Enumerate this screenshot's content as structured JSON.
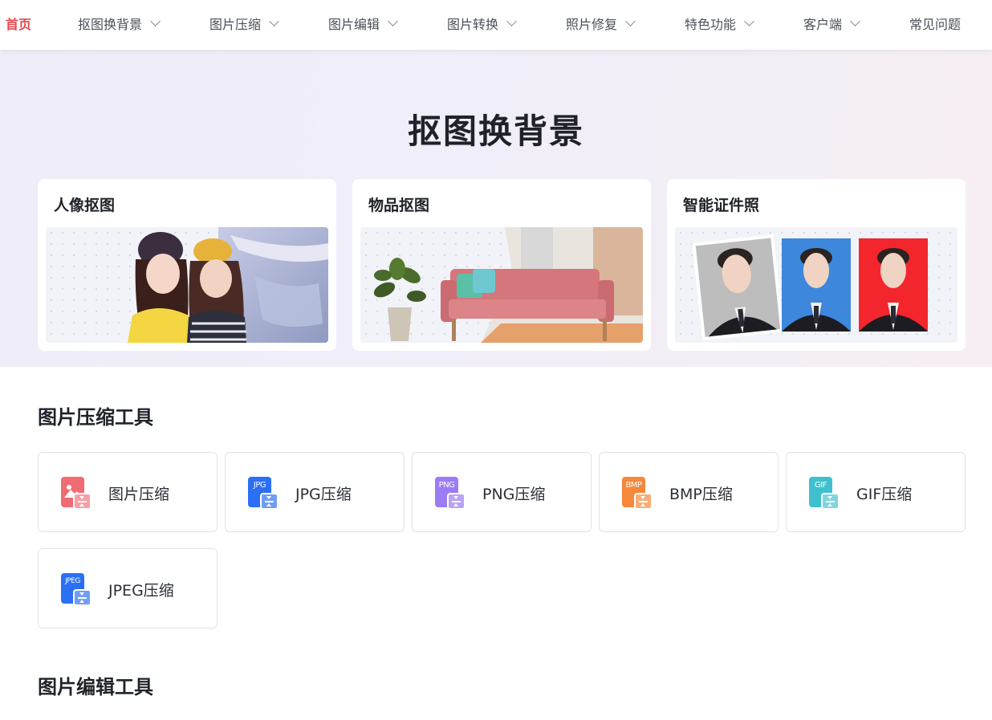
{
  "nav": {
    "home": "首页",
    "items": [
      {
        "label": "抠图换背景"
      },
      {
        "label": "图片压缩"
      },
      {
        "label": "图片编辑"
      },
      {
        "label": "图片转换"
      },
      {
        "label": "照片修复"
      },
      {
        "label": "特色功能"
      },
      {
        "label": "客户端"
      }
    ],
    "faq": "常见问题"
  },
  "hero": {
    "title": "抠图换背景",
    "cards": [
      {
        "title": "人像抠图"
      },
      {
        "title": "物品抠图"
      },
      {
        "title": "智能证件照"
      }
    ]
  },
  "compress": {
    "title": "图片压缩工具",
    "tools": [
      {
        "label": "图片压缩",
        "icon": "image-compress-icon",
        "color": "#f06b72"
      },
      {
        "label": "JPG压缩",
        "icon": "jpg-file-icon",
        "badge": "JPG",
        "color": "#2b6ff5"
      },
      {
        "label": "PNG压缩",
        "icon": "png-file-icon",
        "badge": "PNG",
        "color": "#9b7cf3"
      },
      {
        "label": "BMP压缩",
        "icon": "bmp-file-icon",
        "badge": "BMP",
        "color": "#f5883a"
      },
      {
        "label": "GIF压缩",
        "icon": "gif-file-icon",
        "badge": "GIF",
        "color": "#3fc0cf"
      },
      {
        "label": "JPEG压缩",
        "icon": "jpeg-file-icon",
        "badge": "JPEG",
        "color": "#2b6ff5"
      }
    ]
  },
  "edit": {
    "title": "图片编辑工具"
  },
  "colors": {
    "accent": "#e5484d",
    "text": "#1f2329"
  }
}
